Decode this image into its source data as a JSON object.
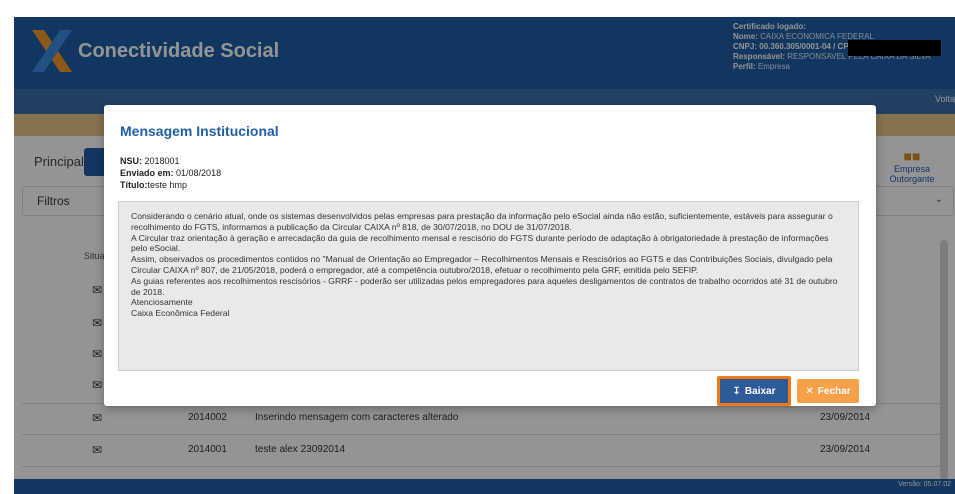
{
  "header": {
    "logo_text": "Conectividade Social",
    "cert_title": "Certificado logado:",
    "cert_nome_label": "Nome:",
    "cert_nome": "CAIXA ECONOMICA FEDERAL",
    "cert_cnpj_label": "CNPJ:",
    "cert_cnpj": "00.360.305/0001-04 / CP",
    "cert_resp_label": "Responsável:",
    "cert_resp": "RESPONSAVEL PELA CAIXA DA SILVA",
    "cert_perfil_label": "Perfil:",
    "cert_perfil": "Empresa",
    "voltar": "Volta"
  },
  "page": {
    "tab_principal": "Principal",
    "empresa_outorgante": "Empresa Outorgante",
    "filtros": "Filtros",
    "situacao_col": "Situa",
    "versao": "Versão: 05.07.02"
  },
  "rows": [
    {
      "num": "2014002",
      "text": "Inserindo mensagem com caracteres alterado",
      "date": "23/09/2014"
    },
    {
      "num": "2014001",
      "text": "teste alex 23092014",
      "date": "23/09/2014"
    }
  ],
  "modal": {
    "title": "Mensagem Institucional",
    "nsu_label": "NSU:",
    "nsu": "2018001",
    "enviado_label": "Enviado em:",
    "enviado": "01/08/2018",
    "titulo_label": "Título:",
    "titulo": "teste hmp",
    "body": [
      "Considerando o cenário atual, onde os sistemas desenvolvidos pelas empresas para prestação da informação pelo eSocial ainda não estão, suficientemente, estáveis para assegurar o recolhimento do FGTS, informamos a publicação da Circular CAIXA nº 818, de 30/07/2018, no DOU de 31/07/2018.",
      "A Circular traz orientação à geração e arrecadação da guia de recolhimento mensal e rescisório do FGTS durante período de adaptação à obrigatoriedade à prestação de informações pelo eSocial.",
      "Assim, observados os procedimentos contidos no \"Manual de Orientação ao Empregador – Recolhimentos Mensais e Rescisórios ao FGTS e das Contribuições Sociais, divulgado pela Circular CAIXA nº 807, de 21/05/2018, poderá o empregador, até a competência outubro/2018, efetuar o recolhimento pela GRF, emitida pelo SEFIP.",
      "As guias referentes aos recolhimentos rescisórios - GRRF - poderão ser utilizadas pelos empregadores para aqueles desligamentos de contratos de trabalho ocorridos até 31 de outubro de 2018.",
      "Atenciosamente",
      "Caixa Econômica Federal"
    ],
    "baixar": "Baixar",
    "fechar": "Fechar"
  }
}
